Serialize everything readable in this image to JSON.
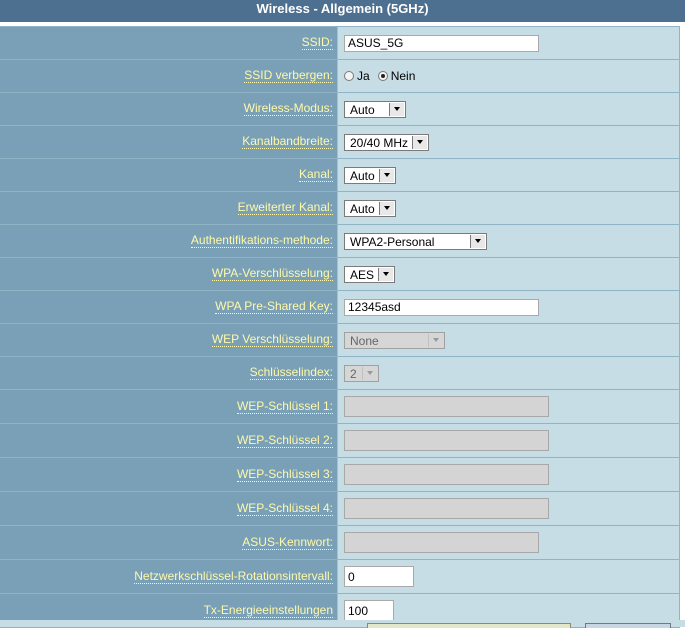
{
  "title": "Wireless - Allgemein (5GHz)",
  "fields": {
    "ssid": {
      "label": "SSID:",
      "value": "ASUS_5G"
    },
    "hide_ssid": {
      "label": "SSID verbergen:",
      "opt_yes": "Ja",
      "opt_no": "Nein",
      "selected": "Nein"
    },
    "wireless_mode": {
      "label": "Wireless-Modus:",
      "value": "Auto"
    },
    "bandwidth": {
      "label": "Kanalbandbreite:",
      "value": "20/40 MHz"
    },
    "channel": {
      "label": "Kanal:",
      "value": "Auto"
    },
    "ext_channel": {
      "label": "Erweiterter Kanal:",
      "value": "Auto"
    },
    "auth_method": {
      "label": "Authentifikations-methode:",
      "value": "WPA2-Personal"
    },
    "wpa_encryption": {
      "label": "WPA-Verschlüsselung:",
      "value": "AES"
    },
    "wpa_psk": {
      "label": "WPA Pre-Shared Key:",
      "value": "12345asd"
    },
    "wep_encryption": {
      "label": "WEP Verschlüsselung:",
      "value": "None"
    },
    "key_index": {
      "label": "Schlüsselindex:",
      "value": "2"
    },
    "wep_key1": {
      "label": "WEP-Schlüssel 1:",
      "value": ""
    },
    "wep_key2": {
      "label": "WEP-Schlüssel 2:",
      "value": ""
    },
    "wep_key3": {
      "label": "WEP-Schlüssel 3:",
      "value": ""
    },
    "wep_key4": {
      "label": "WEP-Schlüssel 4:",
      "value": ""
    },
    "asus_password": {
      "label": "ASUS-Kennwort:",
      "value": ""
    },
    "key_rotation": {
      "label": "Netzwerkschlüssel-Rotationsintervall:",
      "value": "0"
    },
    "tx_power": {
      "label": "Tx-Energieeinstellungen",
      "value": "100"
    }
  },
  "colors": {
    "header_bg": "#4d6f90",
    "label_bg": "#7aa0b8",
    "label_text": "#fff9a8",
    "value_bg": "#c6dde6"
  }
}
